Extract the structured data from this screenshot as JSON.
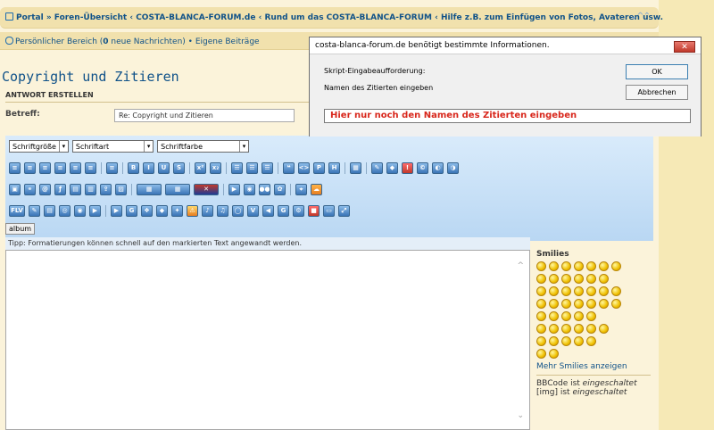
{
  "breadcrumb": {
    "items": [
      "Portal",
      "Foren-Übersicht",
      "COSTA-BLANCA-FORUM.de",
      "Rund um das COSTA-BLANCA-FORUM",
      "Hilfe z.B. zum Einfügen von Fotos, Avateren usw."
    ],
    "sep1": " » ",
    "sep": " ‹ "
  },
  "subnav": {
    "personal_prefix": "Persönlicher Bereich (",
    "new_count": "0",
    "personal_suffix": " neue Nachrichten)",
    "dot": " • ",
    "own_posts": "Eigene Beiträge"
  },
  "page": {
    "title": "Copyright und Zitieren",
    "subheading": "ANTWORT ERSTELLEN",
    "subject_label": "Betreff:",
    "subject_value": "Re: Copyright und Zitieren"
  },
  "editor": {
    "select_size": "Schriftgröße",
    "select_font": "Schriftart",
    "select_color": "Schriftfarbe",
    "album_label": "album",
    "tip": "Tipp: Formatierungen können schnell auf den markierten Text angewandt werden."
  },
  "smilies": {
    "heading": "Smilies",
    "more": "Mehr Smilies anzeigen",
    "bbcode_prefix": "BBCode ist ",
    "bbcode_state": "eingeschaltet",
    "img_prefix": "[img] ist ",
    "img_state": "eingeschaltet"
  },
  "dialog": {
    "title": "costa-blanca-forum.de benötigt bestimmte Informationen.",
    "close": "✕",
    "prompt": "Skript-Eingabeaufforderung:",
    "message": "Namen des Zitierten eingeben",
    "ok": "OK",
    "cancel": "Abbrechen",
    "input_value": "Hier nur noch den Namen des Zitierten eingeben"
  }
}
